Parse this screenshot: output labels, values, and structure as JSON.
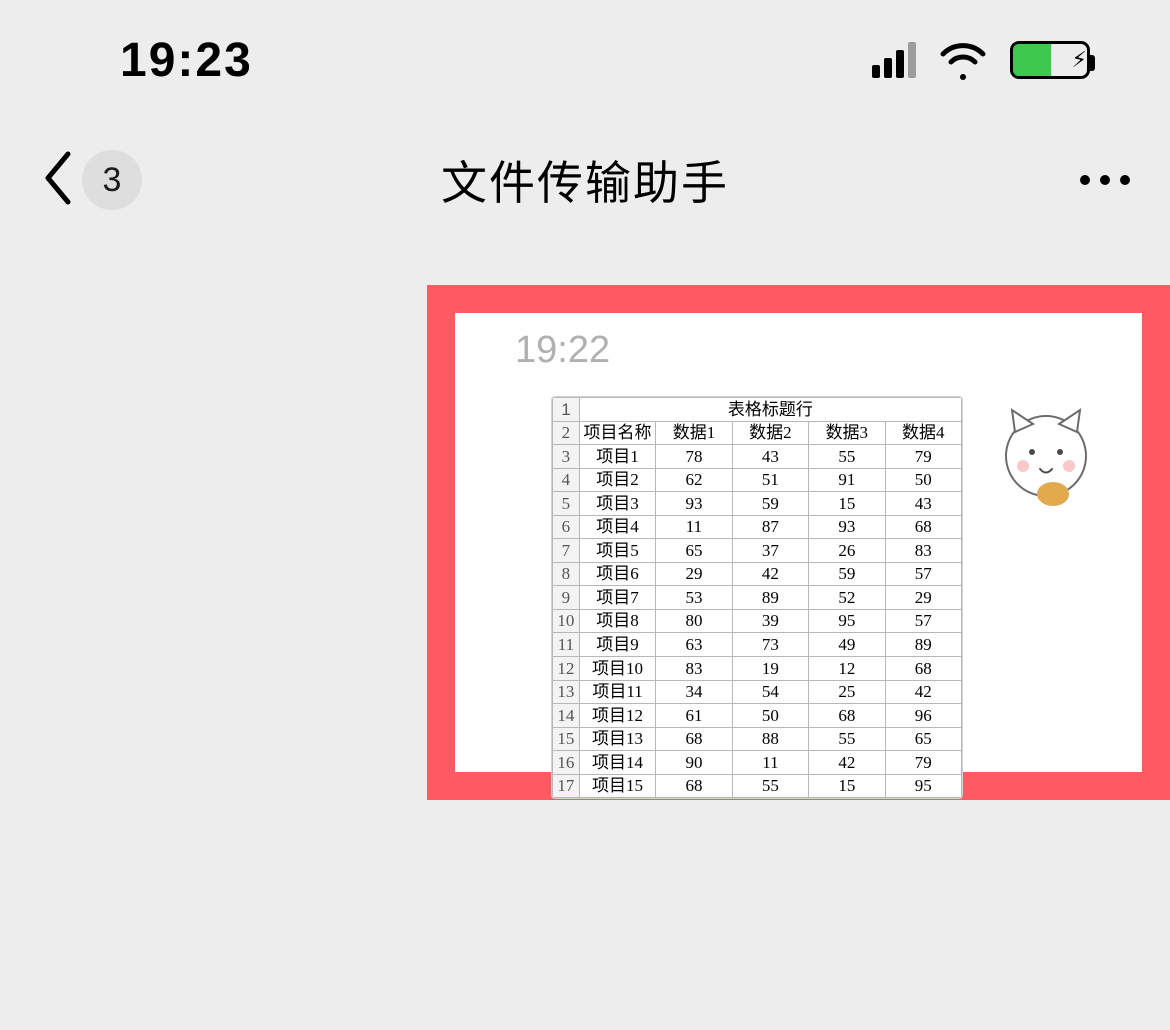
{
  "status": {
    "time": "19:23"
  },
  "nav": {
    "badge": "3",
    "title": "文件传输助手"
  },
  "message": {
    "time": "19:22"
  },
  "chart_data": {
    "type": "table",
    "title": "表格标题行",
    "headers": [
      "项目名称",
      "数据1",
      "数据2",
      "数据3",
      "数据4"
    ],
    "row_numbers": [
      1,
      2,
      3,
      4,
      5,
      6,
      7,
      8,
      9,
      10,
      11,
      12,
      13,
      14,
      15,
      16,
      17
    ],
    "rows": [
      {
        "name": "项目1",
        "v": [
          78,
          43,
          55,
          79
        ]
      },
      {
        "name": "项目2",
        "v": [
          62,
          51,
          91,
          50
        ]
      },
      {
        "name": "项目3",
        "v": [
          93,
          59,
          15,
          43
        ]
      },
      {
        "name": "项目4",
        "v": [
          11,
          87,
          93,
          68
        ]
      },
      {
        "name": "项目5",
        "v": [
          65,
          37,
          26,
          83
        ]
      },
      {
        "name": "项目6",
        "v": [
          29,
          42,
          59,
          57
        ]
      },
      {
        "name": "项目7",
        "v": [
          53,
          89,
          52,
          29
        ]
      },
      {
        "name": "项目8",
        "v": [
          80,
          39,
          95,
          57
        ]
      },
      {
        "name": "项目9",
        "v": [
          63,
          73,
          49,
          89
        ]
      },
      {
        "name": "项目10",
        "v": [
          83,
          19,
          12,
          68
        ]
      },
      {
        "name": "项目11",
        "v": [
          34,
          54,
          25,
          42
        ]
      },
      {
        "name": "项目12",
        "v": [
          61,
          50,
          68,
          96
        ]
      },
      {
        "name": "项目13",
        "v": [
          68,
          88,
          55,
          65
        ]
      },
      {
        "name": "项目14",
        "v": [
          90,
          11,
          42,
          79
        ]
      },
      {
        "name": "项目15",
        "v": [
          68,
          55,
          15,
          95
        ]
      }
    ]
  }
}
